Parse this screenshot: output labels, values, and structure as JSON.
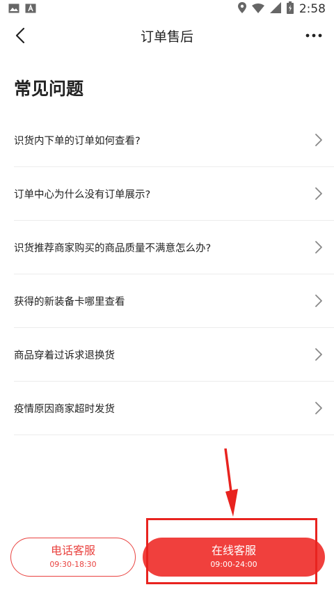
{
  "status_bar": {
    "time": "2:58",
    "left_icons": [
      "image-icon",
      "text-app-icon"
    ],
    "right_icons": [
      "location-icon",
      "wifi-icon",
      "signal-icon",
      "battery-charging-icon"
    ]
  },
  "app_bar": {
    "title": "订单售后",
    "back_icon": "chevron-left-icon",
    "more_icon": "more-dots-icon"
  },
  "section": {
    "title": "常见问题"
  },
  "faq_items": [
    {
      "text": "识货内下单的订单如何查看?"
    },
    {
      "text": "订单中心为什么没有订单展示?"
    },
    {
      "text": "识货推荐商家购买的商品质量不满意怎么办?"
    },
    {
      "text": "获得的新装备卡哪里查看"
    },
    {
      "text": "商品穿着过诉求退换货"
    },
    {
      "text": "疫情原因商家超时发货"
    }
  ],
  "bottom": {
    "phone_service": {
      "label": "电话客服",
      "hours": "09:30-18:30"
    },
    "online_service": {
      "label": "在线客服",
      "hours": "09:00-24:00"
    }
  },
  "colors": {
    "accent": "#f0403d",
    "annotation": "#e8231f"
  }
}
